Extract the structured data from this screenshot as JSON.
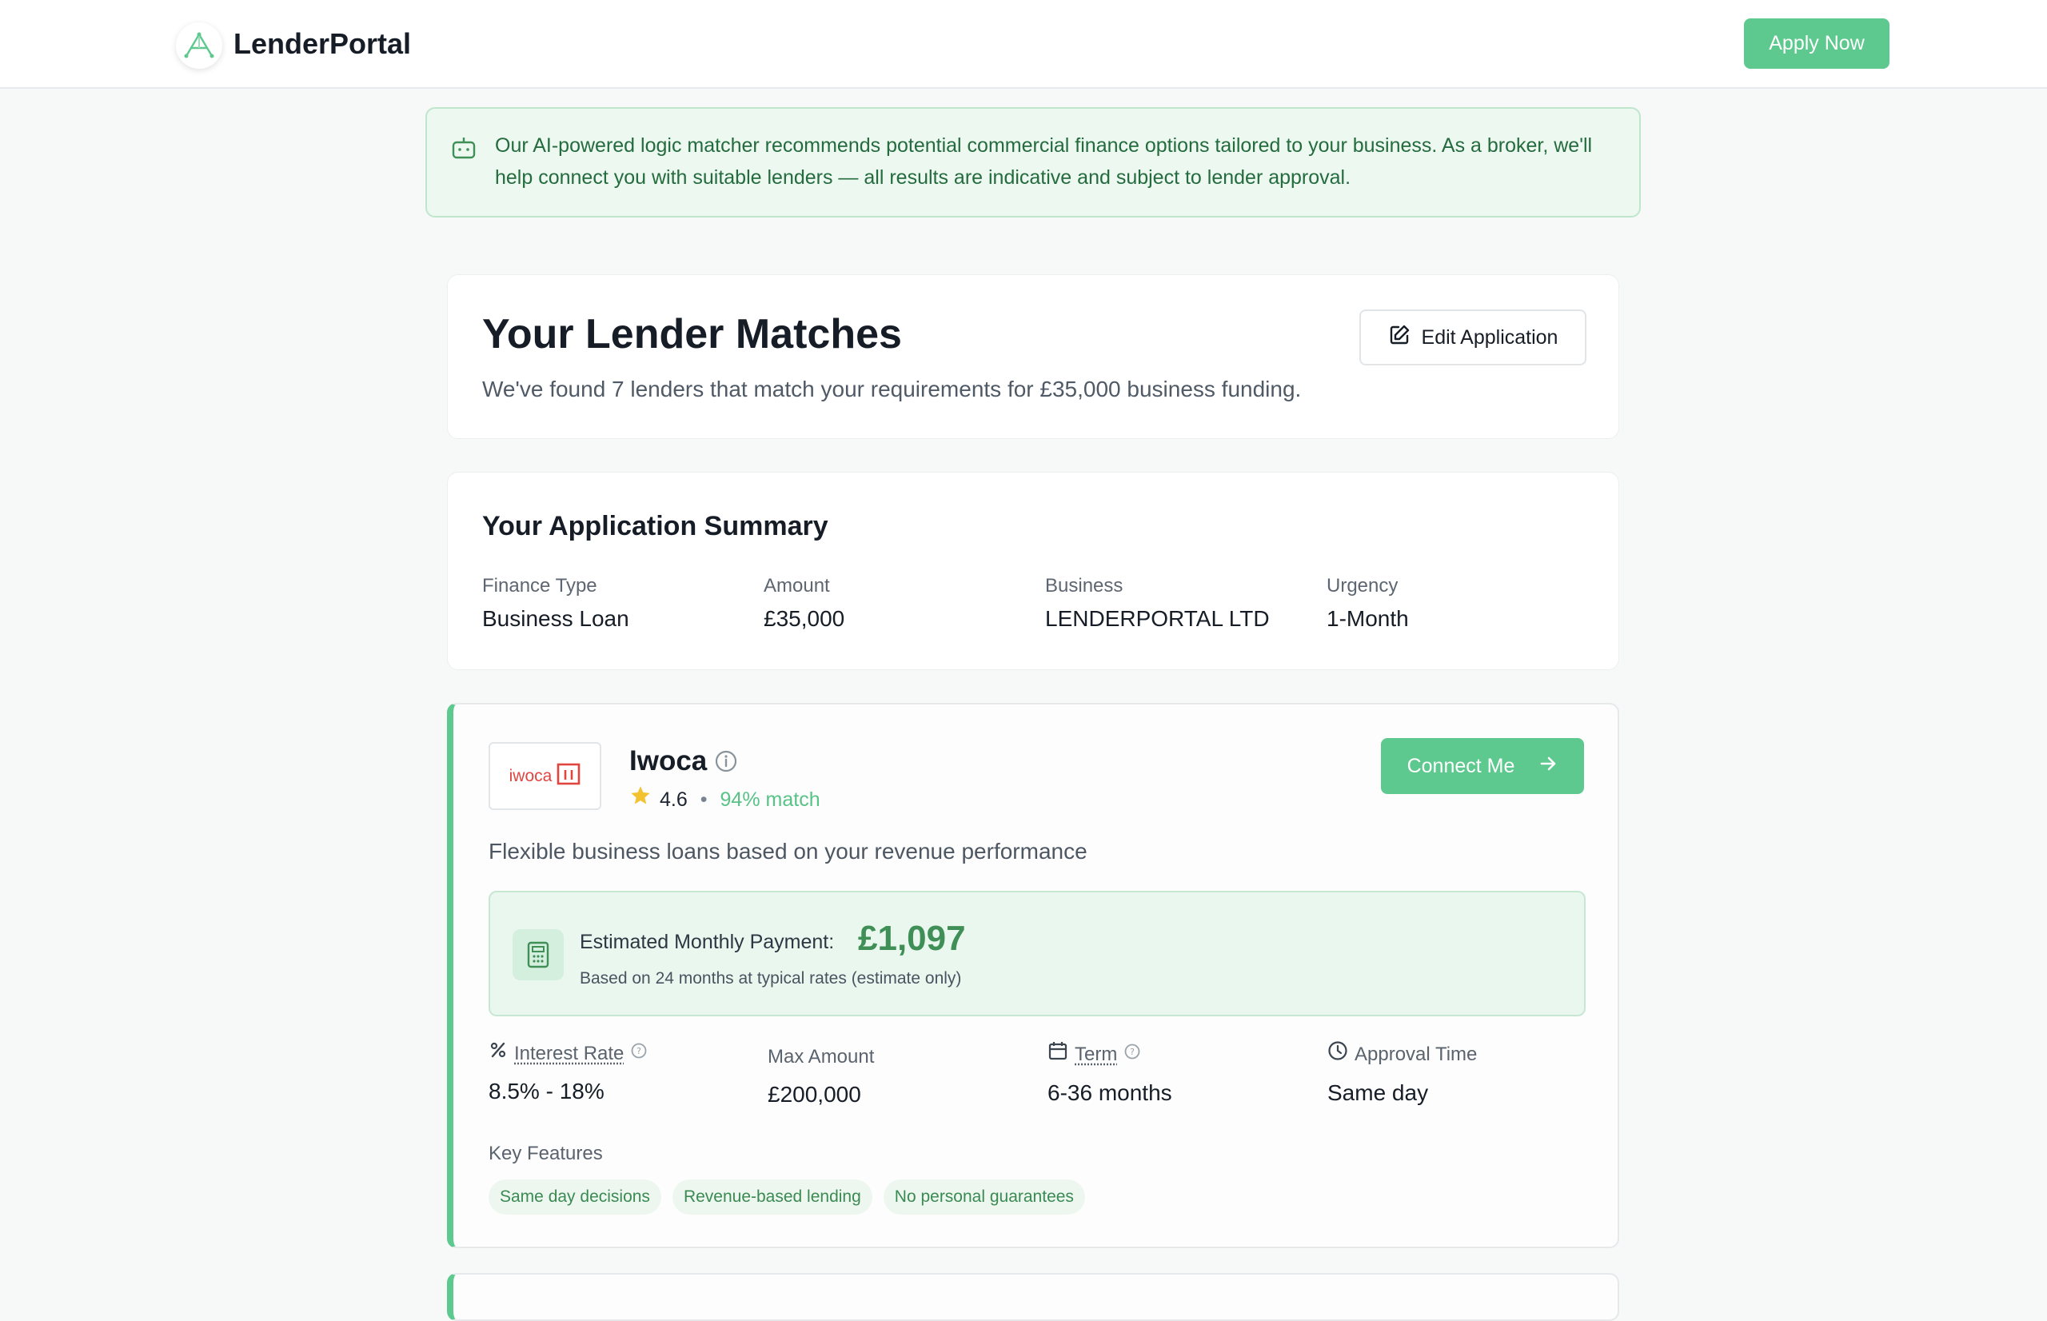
{
  "app": {
    "name": "LenderPortal",
    "apply_label": "Apply Now"
  },
  "notice": {
    "text": "Our AI-powered logic matcher recommends potential commercial finance options tailored to your business. As a broker, we'll help connect you with suitable lenders — all results are indicative and subject to lender approval."
  },
  "matches": {
    "title": "Your Lender Matches",
    "subtitle": "We've found 7 lenders that match your requirements for £35,000 business funding.",
    "edit_label": "Edit Application"
  },
  "summary": {
    "title": "Your Application Summary",
    "fields": [
      {
        "label": "Finance Type",
        "value": "Business Loan"
      },
      {
        "label": "Amount",
        "value": "£35,000"
      },
      {
        "label": "Business",
        "value": "LENDERPORTAL LTD"
      },
      {
        "label": "Urgency",
        "value": "1-Month"
      }
    ]
  },
  "lender": {
    "logo_text": "iwoca",
    "name": "Iwoca",
    "rating": "4.6",
    "separator": "•",
    "match": "94% match",
    "connect_label": "Connect Me",
    "description": "Flexible business loans based on your revenue performance",
    "payment": {
      "label": "Estimated Monthly Payment:",
      "value": "£1,097",
      "note": "Based on 24 months at typical rates (estimate only)"
    },
    "metrics": [
      {
        "label": "Interest Rate",
        "value": "8.5% - 18%",
        "icon": "percent-icon"
      },
      {
        "label": "Max Amount",
        "value": "£200,000",
        "icon": ""
      },
      {
        "label": "Term",
        "value": "6-36 months",
        "icon": "calendar-icon"
      },
      {
        "label": "Approval Time",
        "value": "Same day",
        "icon": "clock-icon"
      }
    ],
    "features_label": "Key Features",
    "features": [
      "Same day decisions",
      "Revenue-based lending",
      "No personal guarantees"
    ]
  },
  "colors": {
    "accent": "#5ec98e",
    "notice_bg": "#ecf8f0",
    "notice_text": "#246b3e",
    "payment_value": "#3f8f57",
    "star": "#f2c230",
    "iwoca_red": "#e0463f"
  }
}
